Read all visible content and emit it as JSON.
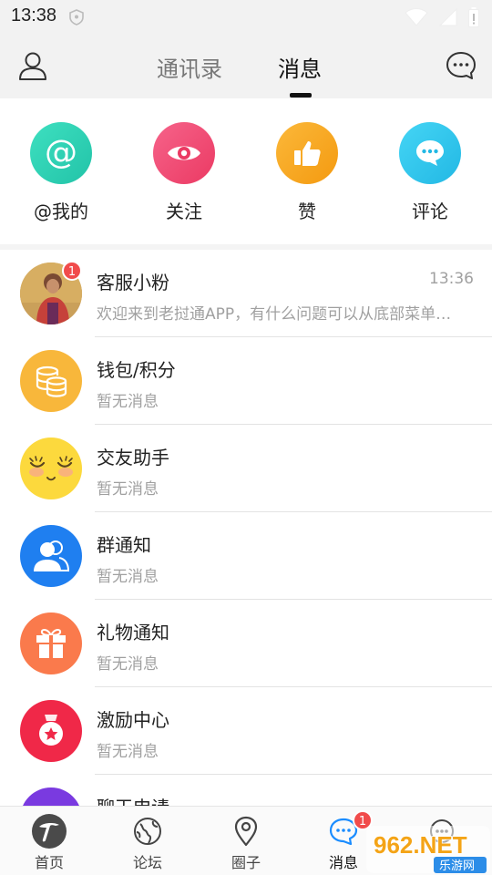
{
  "status_bar": {
    "time": "13:38"
  },
  "header": {
    "tabs": [
      {
        "label": "通讯录",
        "active": false
      },
      {
        "label": "消息",
        "active": true
      }
    ]
  },
  "quick_actions": [
    {
      "label": "@我的",
      "icon": "at-icon",
      "color": "#2fd3b4"
    },
    {
      "label": "关注",
      "icon": "eye-icon",
      "color": "#f04e74"
    },
    {
      "label": "赞",
      "icon": "thumbs-up-icon",
      "color": "#f9a51b"
    },
    {
      "label": "评论",
      "icon": "comment-icon",
      "color": "#34c8ec"
    }
  ],
  "messages": [
    {
      "name": "客服小粉",
      "preview": "欢迎来到老挝通APP，有什么问题可以从底部菜单找到小粉哦",
      "time": "13:36",
      "badge": "1",
      "icon": "user-photo-avatar"
    },
    {
      "name": "钱包/积分",
      "preview": "暂无消息",
      "icon": "coin-stack-icon",
      "color": "#f8b73b"
    },
    {
      "name": "交友助手",
      "preview": "暂无消息",
      "icon": "smiley-face-icon",
      "color": "#fcd93d"
    },
    {
      "name": "群通知",
      "preview": "暂无消息",
      "icon": "group-users-icon",
      "color": "#1f7ff0"
    },
    {
      "name": "礼物通知",
      "preview": "暂无消息",
      "icon": "gift-icon",
      "color": "#fa7a4c"
    },
    {
      "name": "激励中心",
      "preview": "暂无消息",
      "icon": "medal-icon",
      "color": "#f02848"
    },
    {
      "name": "聊天申请",
      "preview": "",
      "icon": "chat-request-icon",
      "color": "#7a3ae0"
    }
  ],
  "bottom_nav": [
    {
      "label": "首页",
      "icon": "home-logo-icon"
    },
    {
      "label": "论坛",
      "icon": "globe-icon"
    },
    {
      "label": "圈子",
      "icon": "location-pin-icon"
    },
    {
      "label": "消息",
      "icon": "message-icon",
      "active": true,
      "badge": "1"
    },
    {
      "label": "",
      "icon": "chat-bubble-icon"
    }
  ],
  "watermark": {
    "brand": "962.NET",
    "sub": "乐游网"
  }
}
